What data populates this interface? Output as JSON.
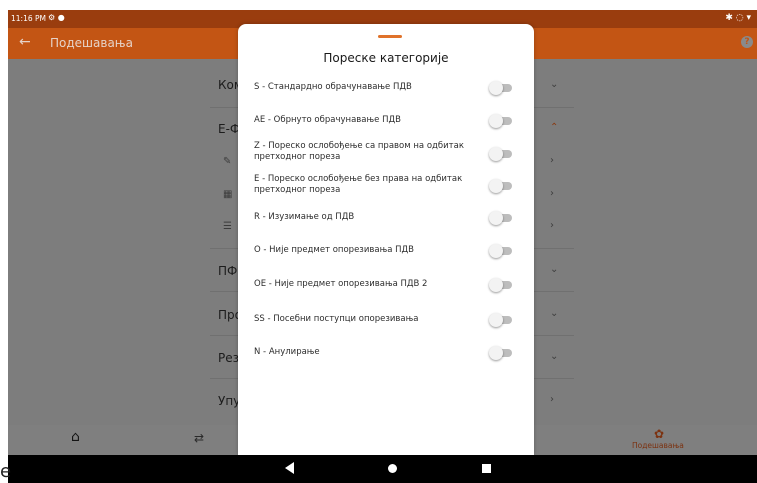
{
  "status_bar": {
    "time": "11:16 PM"
  },
  "app_bar": {
    "title": "Подешавања",
    "back_glyph": "←",
    "help_glyph": "?"
  },
  "background_rows": [
    {
      "label": "Ком"
    },
    {
      "label": "Е-Ф"
    },
    {
      "label": "ПФ"
    },
    {
      "label": "Про"
    },
    {
      "label": "Рез"
    },
    {
      "label": "Упу"
    }
  ],
  "bottom_nav": {
    "settings_label": "Подешавања"
  },
  "sheet": {
    "title": "Пореске категорије",
    "options": [
      {
        "label": "S - Стандардно обрачунавање ПДВ",
        "checked": false
      },
      {
        "label": "AE - Обрнуто обрачунавање ПДВ",
        "checked": false
      },
      {
        "label": "Z - Пореско ослобођење са правом на одбитак претходног пореза",
        "checked": false
      },
      {
        "label": "E - Пореско ослобођење без права на одбитак претходног пореза",
        "checked": false
      },
      {
        "label": "R - Изузимање од ПДВ",
        "checked": false
      },
      {
        "label": "O - Није предмет опорезивања ПДВ",
        "checked": false
      },
      {
        "label": "OE - Није предмет опорезивања ПДВ 2",
        "checked": false
      },
      {
        "label": "SS - Посебни поступци опорезивања",
        "checked": false
      },
      {
        "label": "N - Анулирање",
        "checked": false
      }
    ]
  },
  "stray_text": "e",
  "colors": {
    "primary": "#c35514",
    "status": "#9a3d0e",
    "accent": "#e0722a"
  }
}
